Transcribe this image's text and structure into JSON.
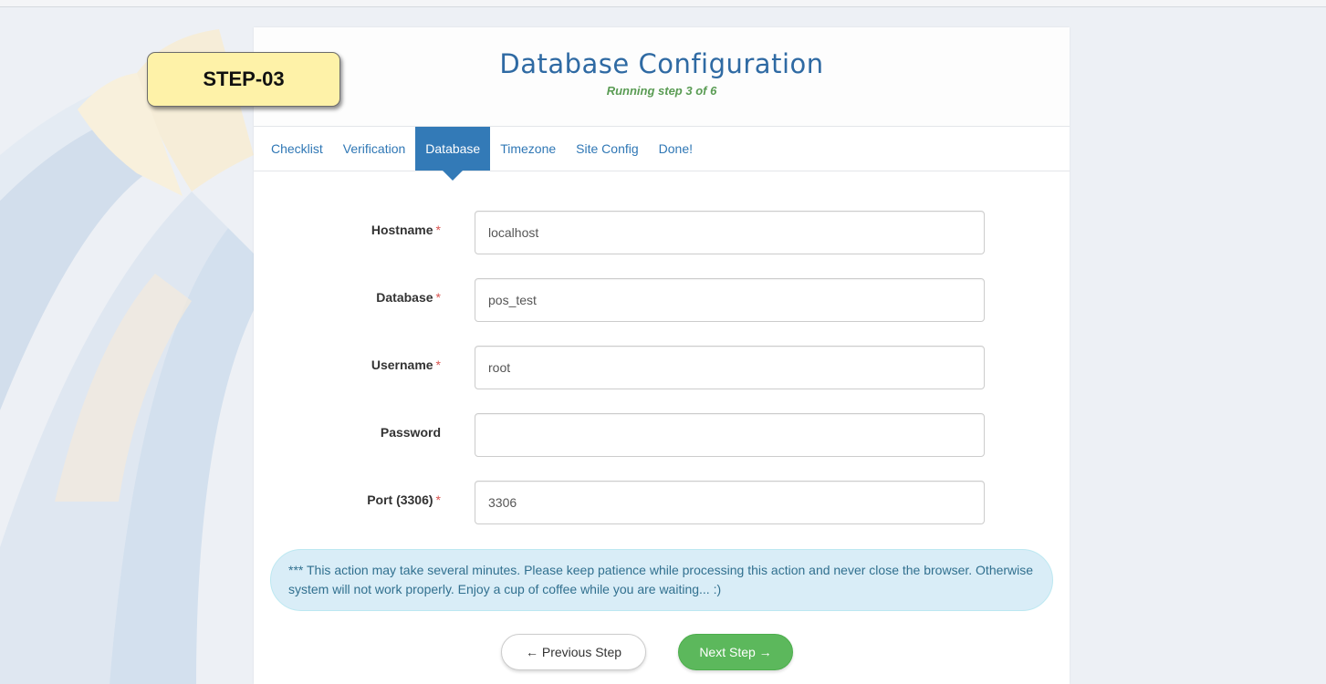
{
  "badge": {
    "label": "STEP-03"
  },
  "header": {
    "title": "Database Configuration",
    "subtitle": "Running step 3 of 6"
  },
  "tabs": [
    {
      "label": "Checklist",
      "active": false
    },
    {
      "label": "Verification",
      "active": false
    },
    {
      "label": "Database",
      "active": true
    },
    {
      "label": "Timezone",
      "active": false
    },
    {
      "label": "Site Config",
      "active": false
    },
    {
      "label": "Done!",
      "active": false
    }
  ],
  "form": {
    "hostname": {
      "label": "Hostname",
      "required_mark": "*",
      "value": "localhost"
    },
    "database": {
      "label": "Database",
      "required_mark": "*",
      "value": "pos_test"
    },
    "username": {
      "label": "Username",
      "required_mark": "*",
      "value": "root"
    },
    "password": {
      "label": "Password",
      "value": ""
    },
    "port": {
      "label": "Port (3306)",
      "required_mark": "*",
      "value": "3306"
    }
  },
  "notice": "*** This action may take several minutes. Please keep patience while processing this action and never close the browser. Otherwise system will not work properly. Enjoy a cup of coffee while you are waiting... :)",
  "buttons": {
    "previous": "← Previous Step",
    "next": "Next Step →"
  },
  "colors": {
    "accent": "#337ab7",
    "title": "#2f6aa3",
    "subtitle": "#5a9c54",
    "badge_bg": "#fef2a8",
    "next_button": "#5cb85c",
    "notice_bg": "#d9edf7"
  }
}
